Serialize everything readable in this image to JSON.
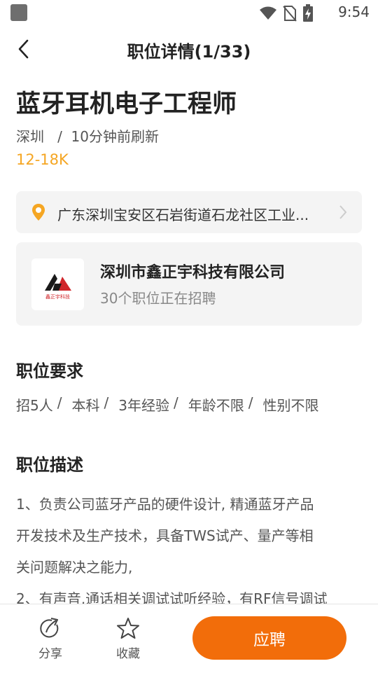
{
  "status_bar": {
    "time": "9:54",
    "icons": [
      "wifi-icon",
      "no-sim-icon",
      "battery-charging-icon"
    ]
  },
  "nav": {
    "back_icon": "chevron-left-icon",
    "title": "职位详情(1/33)"
  },
  "job": {
    "title": "蓝牙耳机电子工程师",
    "city": "深圳",
    "refreshed": "10分钟前刷新",
    "salary": "12-18K",
    "address": "广东深圳宝安区石岩街道石龙社区工业..."
  },
  "company": {
    "name": "深圳市鑫正宇科技有限公司",
    "jobs_count": "30个职位正在招聘",
    "logo_text": "鑫正宇科技"
  },
  "requirements": {
    "heading": "职位要求",
    "items": [
      "招5人",
      "本科",
      "3年经验",
      "年龄不限",
      "性别不限"
    ]
  },
  "description": {
    "heading": "职位描述",
    "lines": [
      "1、负责公司蓝牙产品的硬件设计, 精通蓝牙产品",
      "开发技术及生产技术，具备TWS试产、量产等相",
      "关问题解决之能力,",
      "2、有声音,通话相关调试试听经验，有RF信号调试"
    ]
  },
  "bottom_bar": {
    "share_label": "分享",
    "favorite_label": "收藏",
    "apply_label": "应聘"
  },
  "colors": {
    "accent": "#f26d0a",
    "salary": "#f5a623",
    "card_bg": "#f4f4f4"
  }
}
